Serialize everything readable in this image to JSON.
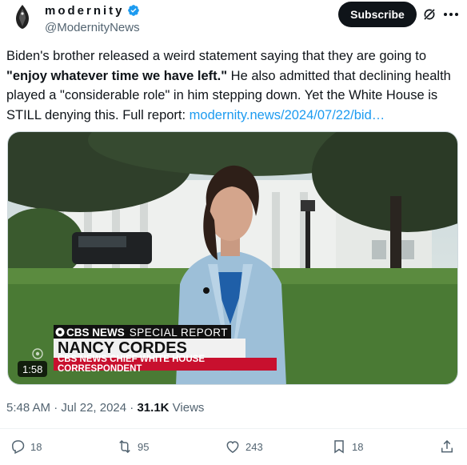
{
  "author": {
    "display_name": "modernity",
    "handle": "@ModernityNews",
    "verified": true
  },
  "header": {
    "subscribe_label": "Subscribe",
    "grok_icon": "grok-icon",
    "more_icon": "more-icon"
  },
  "tweet": {
    "text_part1": "Biden's brother released a weird statement saying that they are going to ",
    "text_bold": "\"enjoy whatever time we have left.\"",
    "text_part2": " He also admitted that declining health played a \"considerable role\" in him stepping down. Yet the White House is STILL denying this. Full report: ",
    "link": "modernity.news/2024/07/22/bid…"
  },
  "media": {
    "duration": "1:58",
    "chyron": {
      "network": "CBS NEWS",
      "segment": "SPECIAL REPORT",
      "name": "NANCY CORDES",
      "title": "CBS NEWS CHIEF WHITE HOUSE CORRESPONDENT"
    }
  },
  "meta": {
    "time": "5:48 AM",
    "separator1": " · ",
    "date": "Jul 22, 2024",
    "separator2": " · ",
    "views_count": "31.1K",
    "views_label": " Views"
  },
  "actions": {
    "replies": "18",
    "reposts": "95",
    "likes": "243",
    "bookmarks": "18"
  },
  "colors": {
    "link": "#1d9bf0",
    "verified": "#1d9bf0",
    "cbs_red": "#c8102e"
  }
}
